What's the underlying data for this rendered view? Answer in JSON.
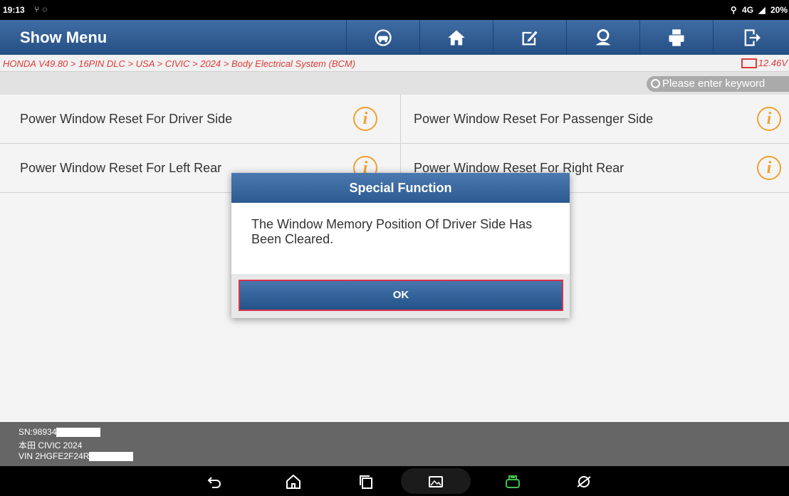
{
  "status_bar": {
    "time": "19:13",
    "left_icons": [
      "usb-icon",
      "chat-icon"
    ],
    "right_text": "4G",
    "battery": "20%"
  },
  "header": {
    "title": "Show Menu",
    "buttons": [
      "vehicle-icon",
      "home-icon",
      "edit-report-icon",
      "user-icon",
      "print-icon",
      "exit-icon"
    ]
  },
  "breadcrumb": {
    "path": "HONDA V49.80 > 16PIN DLC > USA > CIVIC > 2024 > Body Electrical System (BCM)",
    "voltage": "12.46V"
  },
  "search": {
    "placeholder": "Please enter keyword"
  },
  "functions": [
    {
      "label": "Power Window Reset For Driver Side"
    },
    {
      "label": "Power Window Reset For Passenger Side"
    },
    {
      "label": "Power Window Reset For Left Rear"
    },
    {
      "label": "Power Window Reset For Right Rear"
    }
  ],
  "footer": {
    "sn": "SN:98934",
    "vehicle": "本田 CIVIC 2024",
    "vin": "VIN 2HGFE2F24R"
  },
  "dialog": {
    "title": "Special Function",
    "message": "The Window Memory Position Of Driver Side Has Been Cleared.",
    "ok_label": "OK"
  },
  "colors": {
    "header_blue": "#2f5d94",
    "breadcrumb_red": "#e03a3a",
    "info_orange": "#f0a030",
    "ok_border": "#d6334b"
  }
}
